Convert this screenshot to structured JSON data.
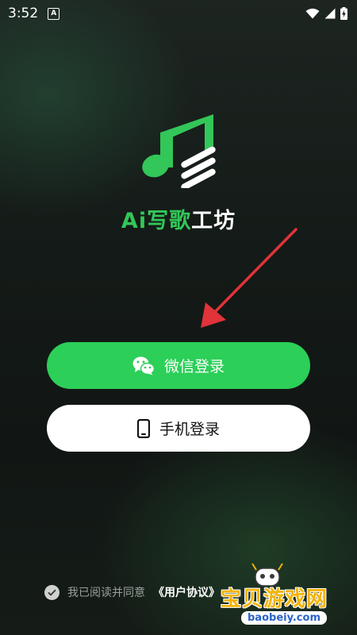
{
  "status_bar": {
    "time": "3:52",
    "notification_icon": "a-letter-icon",
    "icons": [
      "wifi-icon",
      "signal-icon",
      "battery-charging-icon"
    ]
  },
  "app": {
    "title_part1": "Ai写",
    "title_part2": "歌",
    "title_part3": "工坊",
    "logo_icon": "music-note-logo-icon"
  },
  "buttons": {
    "wechat_label": "微信登录",
    "phone_label": "手机登录"
  },
  "agreement": {
    "prefix": "我已阅读并同意",
    "link": "《用户协议》",
    "checked": true
  },
  "watermark": {
    "text": "宝贝游戏网",
    "url": "baobeiy.com"
  },
  "colors": {
    "accent_green": "#2ccf58",
    "title_green": "#33c659",
    "arrow_red": "#e0333a",
    "watermark_yellow": "#f2b300"
  }
}
